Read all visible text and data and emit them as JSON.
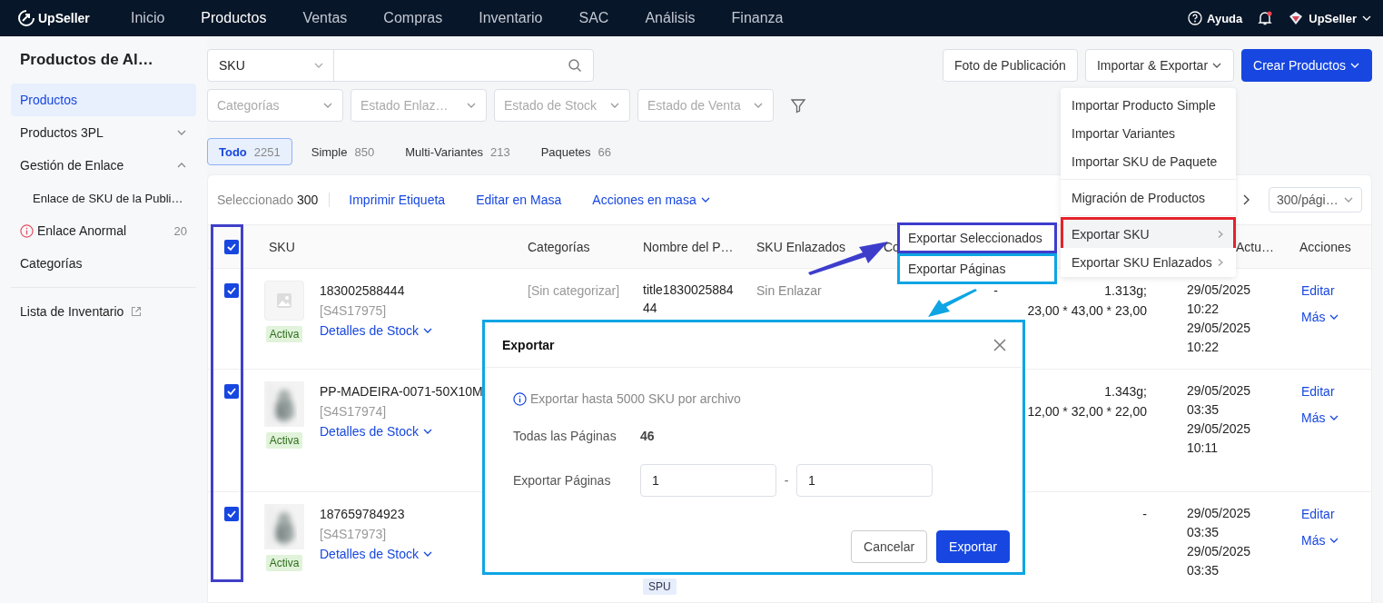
{
  "nav": {
    "brand": "UpSeller",
    "items": [
      {
        "label": "Inicio",
        "selected": false
      },
      {
        "label": "Productos",
        "selected": true
      },
      {
        "label": "Ventas",
        "selected": false
      },
      {
        "label": "Compras",
        "selected": false
      },
      {
        "label": "Inventario",
        "selected": false
      },
      {
        "label": "SAC",
        "selected": false
      },
      {
        "label": "Análisis",
        "selected": false
      },
      {
        "label": "Finanza",
        "selected": false
      }
    ],
    "help": "Ayuda",
    "notification_dot": true,
    "account": "UpSeller"
  },
  "sidebar": {
    "title": "Productos de Al…",
    "items": [
      {
        "label": "Productos",
        "kind": "link",
        "selected": true
      },
      {
        "label": "Productos 3PL",
        "kind": "group",
        "selected": false,
        "expanded": false
      },
      {
        "label": "Gestión de Enlace",
        "kind": "group",
        "selected": false,
        "expanded": true,
        "children": [
          {
            "label": "Enlace de SKU de la Publi…",
            "kind": "link",
            "selected": false
          }
        ]
      },
      {
        "label": "Enlace Anormal",
        "kind": "alert",
        "selected": false,
        "count": "20"
      },
      {
        "label": "Categorías",
        "kind": "link",
        "selected": false
      },
      {
        "label": "Lista de Inventario",
        "kind": "external",
        "selected": false
      }
    ]
  },
  "search": {
    "selector": "SKU"
  },
  "buttons": [
    {
      "label": "Foto de Publicación",
      "kind": "plain"
    },
    {
      "label": "Importar & Exportar",
      "kind": "menu"
    },
    {
      "label": "Crear Productos",
      "kind": "primary"
    }
  ],
  "filters": [
    {
      "placeholder": "Categorías"
    },
    {
      "placeholder": "Estado Enlaz…"
    },
    {
      "placeholder": "Estado de Stock"
    },
    {
      "placeholder": "Estado de Venta"
    }
  ],
  "tabs": [
    {
      "label": "Todo",
      "count": "2251",
      "selected": true
    },
    {
      "label": "Simple",
      "count": "850",
      "selected": false
    },
    {
      "label": "Multi-Variantes",
      "count": "213",
      "selected": false
    },
    {
      "label": "Paquetes",
      "count": "66",
      "selected": false
    }
  ],
  "bulk_bar": {
    "selected_label": "Seleccionado",
    "selected_count": "300",
    "actions": [
      {
        "label": "Imprimir Etiqueta",
        "kind": "link"
      },
      {
        "label": "Editar en Masa",
        "kind": "link"
      },
      {
        "label": "Acciones en masa",
        "kind": "menu"
      }
    ],
    "page_size": "300/pági…"
  },
  "table": {
    "all_checked": true,
    "columns": [
      {
        "label": "SKU"
      },
      {
        "label": "Categorías"
      },
      {
        "label": "Nombre del P…"
      },
      {
        "label": "SKU Enlazados"
      },
      {
        "label": "Co"
      },
      {
        "label": "Actu…"
      },
      {
        "label": "Acciones"
      }
    ],
    "rows": [
      {
        "checked": true,
        "image": {
          "kind": "placeholder"
        },
        "status": "Activa",
        "sku": "183002588444",
        "code": "[S4S17975]",
        "stock_link": "Detalles de Stock",
        "category": "[Sin categorizar]",
        "name": "title183002588444",
        "linked": "Sin Enlazar",
        "column_5": "-",
        "weight": [
          "1.313g;",
          "23,00 * 43,00 * 23,00"
        ],
        "dates": [
          "29/05/2025 10:22",
          "29/05/2025 10:22"
        ],
        "actions": [
          "Editar",
          "Más"
        ]
      },
      {
        "checked": true,
        "image": {
          "kind": "picture"
        },
        "status": "Activa",
        "sku": "PP-MADEIRA-0071-50X10M",
        "code": "[S4S17974]",
        "stock_link": "Detalles de Stock",
        "weight": [
          "1.343g;",
          "12,00 * 32,00 * 22,00"
        ],
        "dates": [
          "29/05/2025 03:35",
          "29/05/2025 10:11"
        ],
        "actions": [
          "Editar",
          "Más"
        ]
      },
      {
        "checked": true,
        "image": {
          "kind": "picture"
        },
        "status": "Activa",
        "sku": "187659784923",
        "code": "[S4S17973]",
        "stock_link": "Detalles de Stock",
        "tag": "SPU",
        "weight": [
          "-"
        ],
        "dates": [
          "29/05/2025 03:35",
          "29/05/2025 03:35"
        ],
        "actions": [
          "Editar",
          "Más"
        ]
      }
    ]
  },
  "menu": {
    "groups": [
      [
        {
          "label": "Importar Producto Simple",
          "kind": "action",
          "selected": false
        },
        {
          "label": "Importar Variantes",
          "kind": "action",
          "selected": false
        },
        {
          "label": "Importar SKU de Paquete",
          "kind": "action",
          "selected": false
        }
      ],
      [
        {
          "label": "Migración de Productos",
          "kind": "action",
          "selected": false
        }
      ],
      [
        {
          "label": "Exportar SKU",
          "kind": "submenu",
          "selected": true,
          "color": "#e5222c"
        },
        {
          "label": "Exportar SKU Enlazados",
          "kind": "submenu",
          "selected": false
        }
      ]
    ]
  },
  "submenu": {
    "items": [
      {
        "label": "Exportar Seleccionados",
        "color": "#3d3dcc"
      },
      {
        "label": "Exportar Páginas",
        "color": "#0ea5e4"
      }
    ]
  },
  "dialog": {
    "title": "Exportar",
    "notice": "Exportar hasta 5000 SKU por archivo",
    "fields": [
      {
        "label": "Todas las Páginas",
        "kind": "value",
        "value": "46"
      },
      {
        "label": "Exportar Páginas",
        "kind": "range",
        "from": "1",
        "separator": "-",
        "to": "1"
      }
    ],
    "buttons": [
      {
        "label": "Cancelar",
        "kind": "secondary"
      },
      {
        "label": "Exportar",
        "kind": "primary"
      }
    ]
  }
}
